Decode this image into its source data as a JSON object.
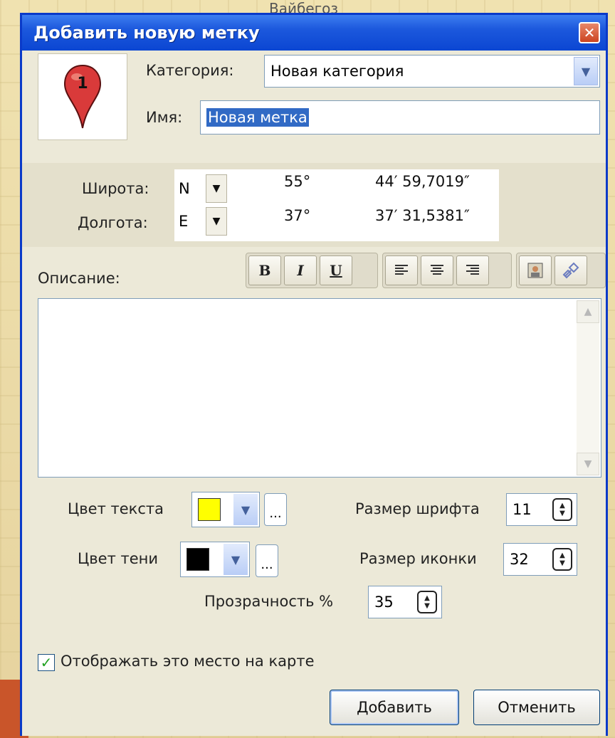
{
  "background": {
    "map_label": "Вайбегоз"
  },
  "dialog": {
    "title": "Добавить новую метку",
    "close_glyph": "✕"
  },
  "marker": {
    "number": "1",
    "color": "#d93a3a"
  },
  "category": {
    "label": "Категория:",
    "value": "Новая категория"
  },
  "name": {
    "label": "Имя:",
    "value": "Новая метка"
  },
  "coordinates": {
    "latitude_label": "Широта:",
    "latitude_hemisphere": "N",
    "latitude_degrees": "55°",
    "latitude_minutes_seconds": "44′ 59,7019″",
    "longitude_label": "Долгота:",
    "longitude_hemisphere": "E",
    "longitude_degrees": "37°",
    "longitude_minutes_seconds": "37′ 31,5381″"
  },
  "description": {
    "label": "Описание:",
    "value": ""
  },
  "toolbar": {
    "bold": "B",
    "italic": "I",
    "underline": "U"
  },
  "text_color": {
    "label": "Цвет текста",
    "value": "#ffff00",
    "more": "..."
  },
  "shadow_color": {
    "label": "Цвет тени",
    "value": "#000000",
    "more": "..."
  },
  "font_size": {
    "label": "Размер шрифта",
    "value": "11"
  },
  "icon_size": {
    "label": "Размер иконки",
    "value": "32"
  },
  "transparency": {
    "label": "Прозрачность %",
    "value": "35"
  },
  "show_on_map": {
    "label": "Отображать это место на карте",
    "checked": true
  },
  "buttons": {
    "add": "Добавить",
    "cancel": "Отменить"
  },
  "colors": {
    "title_bar": "#0b46d2",
    "dialog_bg": "#ece9d8",
    "accent": "#316ac5"
  }
}
